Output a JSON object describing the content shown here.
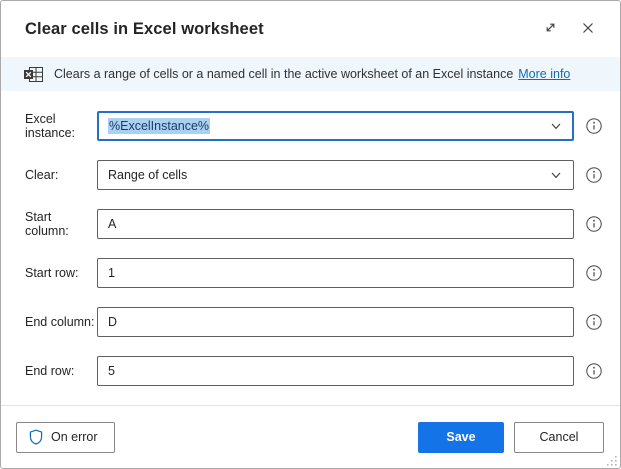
{
  "dialog": {
    "title": "Clear cells in Excel worksheet"
  },
  "header": {
    "icons": [
      "expand-icon",
      "close-icon"
    ]
  },
  "description": {
    "icon": "excel-action-icon",
    "text": "Clears a range of cells or a named cell in the active worksheet of an Excel instance",
    "link_label": "More info"
  },
  "form": {
    "rows": [
      {
        "label": "Excel instance:",
        "type": "combobox",
        "value": "%ExcelInstance%",
        "state": "focused, value selected"
      },
      {
        "label": "Clear:",
        "type": "combobox",
        "value": "Range of cells"
      },
      {
        "label": "Start column:",
        "type": "text",
        "value": "A"
      },
      {
        "label": "Start row:",
        "type": "text",
        "value": "1"
      },
      {
        "label": "End column:",
        "type": "text",
        "value": "D"
      },
      {
        "label": "End row:",
        "type": "text",
        "value": "5"
      }
    ],
    "info_icon": "info-circle-icon"
  },
  "footer": {
    "on_error_label": "On error",
    "save_label": "Save",
    "cancel_label": "Cancel"
  },
  "colors": {
    "accent_primary": "#1473e6",
    "link_blue": "#0f6cbd",
    "focus_border": "#2470c8",
    "selection_highlight": "#a9d1f1",
    "description_bar_bg": "#eff6fc",
    "input_border": "#60605e",
    "dialog_border": "#a9a9a9"
  }
}
